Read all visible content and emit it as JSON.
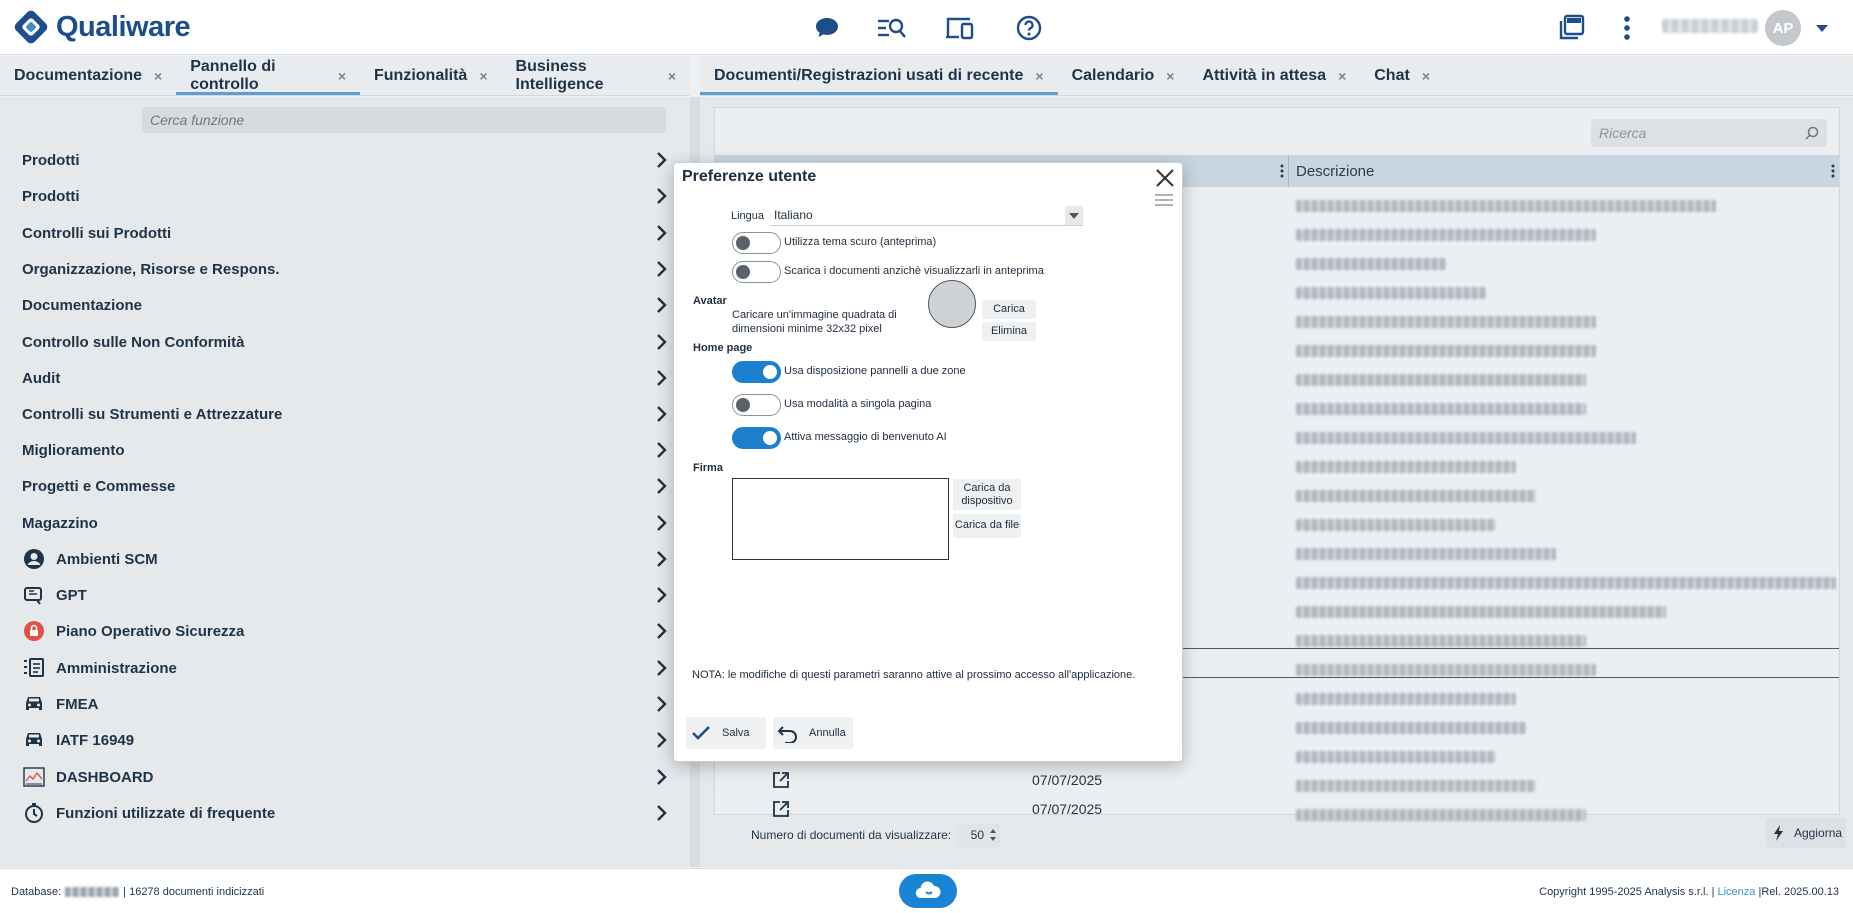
{
  "header": {
    "logo_text": "Qualiware",
    "avatar_initials": "AP"
  },
  "left_tabs": [
    {
      "label": "Documentazione"
    },
    {
      "label": "Pannello di controllo"
    },
    {
      "label": "Funzionalità"
    },
    {
      "label": "Business Intelligence"
    }
  ],
  "right_tabs": [
    {
      "label": "Documenti/Registrazioni usati di recente"
    },
    {
      "label": "Calendario"
    },
    {
      "label": "Attività in attesa"
    },
    {
      "label": "Chat"
    }
  ],
  "tab_close_glyph": "×",
  "left_panel": {
    "search_placeholder": "Cerca funzione",
    "menu": [
      {
        "label": "Prodotti",
        "icon": ""
      },
      {
        "label": "Prodotti",
        "icon": ""
      },
      {
        "label": "Controlli sui Prodotti",
        "icon": ""
      },
      {
        "label": "Organizzazione, Risorse e Respons.",
        "icon": ""
      },
      {
        "label": "Documentazione",
        "icon": ""
      },
      {
        "label": "Controllo sulle Non Conformità",
        "icon": ""
      },
      {
        "label": "Audit",
        "icon": ""
      },
      {
        "label": "Controlli su Strumenti e Attrezzature",
        "icon": ""
      },
      {
        "label": "Miglioramento",
        "icon": ""
      },
      {
        "label": "Progetti e Commesse",
        "icon": ""
      },
      {
        "label": "Magazzino",
        "icon": ""
      },
      {
        "label": "Ambienti SCM",
        "icon": "account-circle-icon"
      },
      {
        "label": "GPT",
        "icon": "gpt-icon"
      },
      {
        "label": "Piano Operativo Sicurezza",
        "icon": "lock-badge-icon"
      },
      {
        "label": "Amministrazione",
        "icon": "list-icon"
      },
      {
        "label": "FMEA",
        "icon": "car-icon"
      },
      {
        "label": "IATF 16949",
        "icon": "car-icon"
      },
      {
        "label": "DASHBOARD",
        "icon": "chart-icon"
      },
      {
        "label": "Funzioni utilizzate di frequente",
        "icon": "clock-icon"
      }
    ]
  },
  "right_panel": {
    "search_placeholder": "Ricerca",
    "col_descrizione": "Descrizione",
    "visible_dates": [
      "07/07/2025",
      "07/07/2025"
    ],
    "num_docs_label": "Numero di documenti da visualizzare:",
    "num_docs_value": "50",
    "refresh_label": "Aggiorna"
  },
  "status": {
    "database_label": "Database:",
    "indexed_docs": "16278 documenti indicizzati",
    "sep": "|",
    "copyright": "Copyright 1995-2025 Analysis s.r.l.",
    "license": "Licenza",
    "release": "Rel.  2025.00.13"
  },
  "dialog": {
    "title": "Preferenze utente",
    "lingua_label": "Lingua",
    "lingua_value": "Italiano",
    "dark_theme_label": "Utilizza tema scuro (anteprima)",
    "dark_theme_on": false,
    "download_docs_label": "Scarica i documenti anzichè visualizzarli in anteprima",
    "download_docs_on": false,
    "avatar_section": "Avatar",
    "avatar_hint_1": "Caricare un'immagine quadrata di",
    "avatar_hint_2": "dimensioni minime 32x32 pixel",
    "avatar_upload": "Carica",
    "avatar_delete": "Elimina",
    "home_section": "Home page",
    "two_zones_label": "Usa disposizione pannelli a due zone",
    "two_zones_on": true,
    "single_page_label": "Usa modalità a singola pagina",
    "single_page_on": false,
    "ai_welcome_label": "Attiva messaggio di benvenuto AI",
    "ai_welcome_on": true,
    "signature_section": "Firma",
    "sig_from_device_1": "Carica da",
    "sig_from_device_2": "dispositivo",
    "sig_from_file": "Carica da file",
    "note": "NOTA: le modifiche di questi parametri saranno attive al prossimo accesso all'applicazione.",
    "save": "Salva",
    "cancel": "Annulla"
  },
  "colors": {
    "brand": "#1d4e89",
    "accent": "#1b7fce",
    "tab_underline": "#5aa0d6",
    "danger_icon": "#e05247"
  }
}
